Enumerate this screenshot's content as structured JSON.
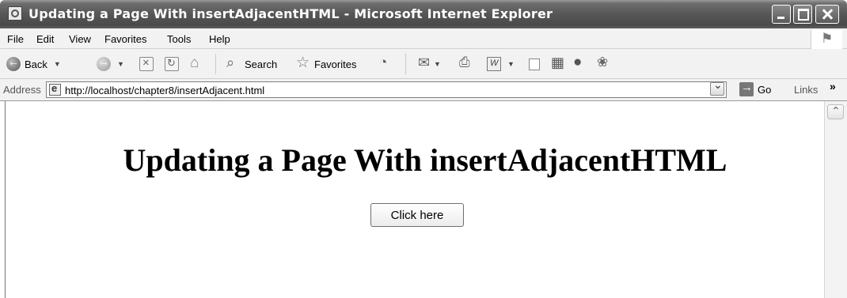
{
  "window": {
    "title": "Updating a Page With insertAdjacentHTML - Microsoft Internet Explorer"
  },
  "menubar": {
    "items": [
      "File",
      "Edit",
      "View",
      "Favorites",
      "Tools",
      "Help"
    ]
  },
  "toolbar": {
    "back_label": "Back",
    "search_label": "Search",
    "favorites_label": "Favorites"
  },
  "address": {
    "label": "Address",
    "url": "http://localhost/chapter8/insertAdjacent.html",
    "go_label": "Go",
    "links_label": "Links",
    "links_chevron": "»"
  },
  "page": {
    "heading": "Updating a Page With insertAdjacentHTML",
    "button_label": "Click here"
  }
}
